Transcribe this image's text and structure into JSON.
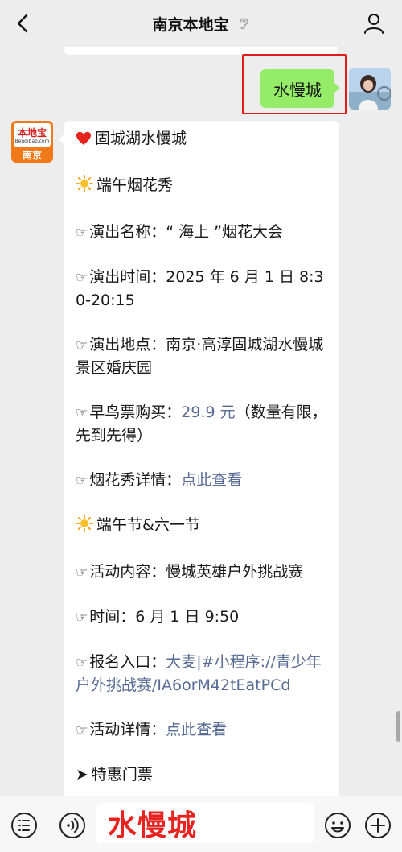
{
  "header": {
    "title": "南京本地宝"
  },
  "chat": {
    "my_message": "水慢城",
    "bot_avatar": {
      "brand": "本地宝",
      "domain": "Bendibao.com",
      "city": "南京"
    },
    "reply": {
      "title": "固城湖水慢城",
      "section1": "端午烟花秀",
      "show_name": "演出名称：“ 海上 ”烟花大会",
      "show_time": "演出时间：2025 年 6 月 1 日 8:30-20:15",
      "show_place": "演出地点：南京·高淳固城湖水慢城景区婚庆园",
      "early_label": "早鸟票购买：",
      "early_price": "29.9 元",
      "early_note": "（数量有限，先到先得）",
      "fireworks_label": "烟花秀详情：",
      "fireworks_link": "点此查看",
      "section2": "端午节&六一节",
      "activity": "活动内容：慢城英雄户外挑战赛",
      "time": "时间：6 月 1 日 9:50",
      "signup_label": "报名入口：",
      "signup_link": "大麦|#小程序://青少年户外挑战赛/IA6orM42tEatPCd",
      "detail_label": "活动详情：",
      "detail_link": "点此查看",
      "tickets": "特惠门票"
    }
  },
  "input": {
    "value": "水慢城"
  },
  "icons": {
    "back": "chevron-left-icon",
    "ear": "ear-icon",
    "profile": "person-icon",
    "menu": "list-menu-icon",
    "voice": "voice-icon",
    "emoji": "emoji-icon",
    "add": "plus-icon"
  },
  "colors": {
    "my_bubble": "#95ec69",
    "link": "#576b95",
    "highlight": "#e21b1b",
    "input_text": "#e8231f"
  }
}
